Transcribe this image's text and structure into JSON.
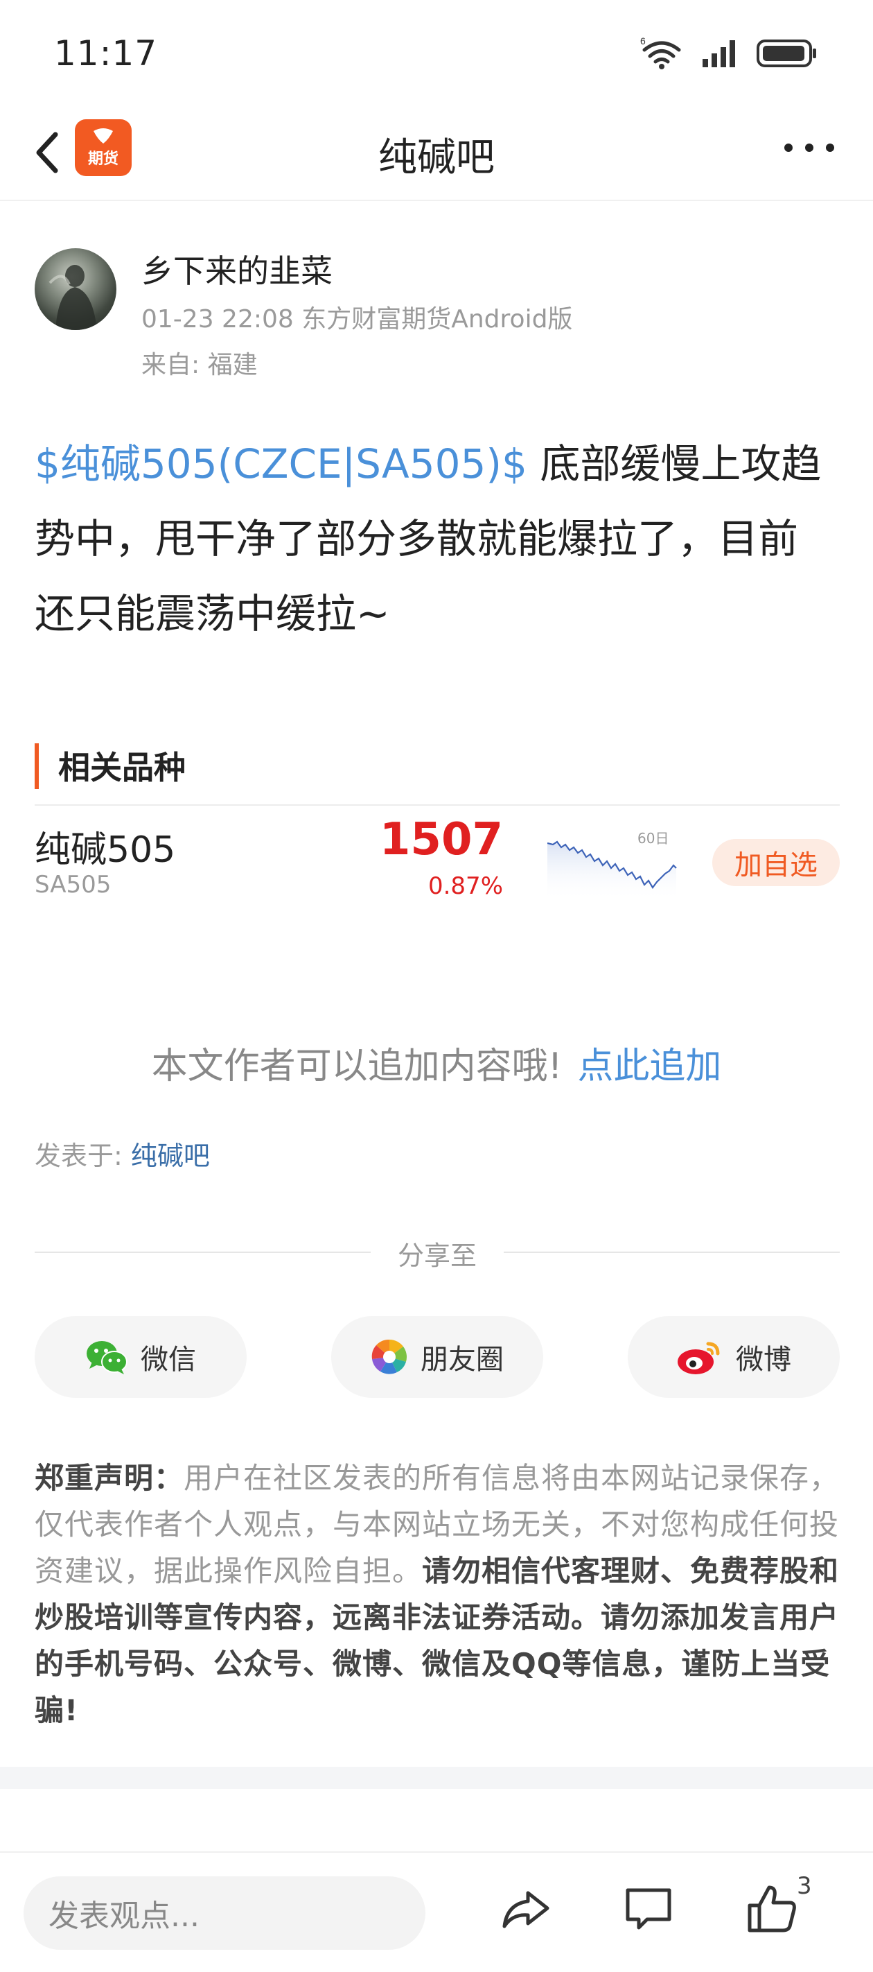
{
  "status_bar": {
    "time": "11:17",
    "icons": [
      "wifi-icon",
      "signal-icon",
      "battery-icon"
    ]
  },
  "nav": {
    "title": "纯碱吧",
    "app_logo_text": "期货",
    "back_icon": "chevron-left-icon",
    "more_icon": "more-dots-icon"
  },
  "author": {
    "name": "乡下来的韭菜",
    "meta": "01-23 22:08 东方财富期货Android版",
    "location": "来自: 福建"
  },
  "post": {
    "stock_tag": "$纯碱505(CZCE|SA505)$",
    "text_line1": " 底部缓慢上攻趋",
    "text_line2": "势中，甩干净了部分多散就能爆拉了，目前",
    "text_line3": "还只能震荡中缓拉~"
  },
  "related": {
    "title": "相关品种",
    "quote": {
      "name": "纯碱505",
      "code": "SA505",
      "price": "1507",
      "change": "0.87%",
      "spark_label": "60日",
      "add_label": "加自选"
    }
  },
  "append": {
    "text": "本文作者可以追加内容哦!",
    "link": "点此追加"
  },
  "posted_in": {
    "label": "发表于: ",
    "link": "纯碱吧"
  },
  "share": {
    "label": "分享至",
    "buttons": [
      {
        "label": "微信",
        "icon": "wechat-icon"
      },
      {
        "label": "朋友圈",
        "icon": "moments-icon"
      },
      {
        "label": "微博",
        "icon": "weibo-icon"
      }
    ]
  },
  "disclaimer": {
    "heading": "郑重声明：",
    "body": "用户在社区发表的所有信息将由本网站记录保存，仅代表作者个人观点，与本网站立场无关，不对您构成任何投资建议，据此操作风险自担。",
    "warning": "请勿相信代客理财、免费荐股和炒股培训等宣传内容，远离非法证券活动。请勿添加发言用户的手机号码、公众号、微博、微信及QQ等信息，谨防上当受骗!"
  },
  "bottom_bar": {
    "input_placeholder": "发表观点...",
    "like_count": "3"
  },
  "colors": {
    "accent_orange": "#f05a22",
    "price_red": "#e02020",
    "link_blue": "#4a90d9"
  }
}
